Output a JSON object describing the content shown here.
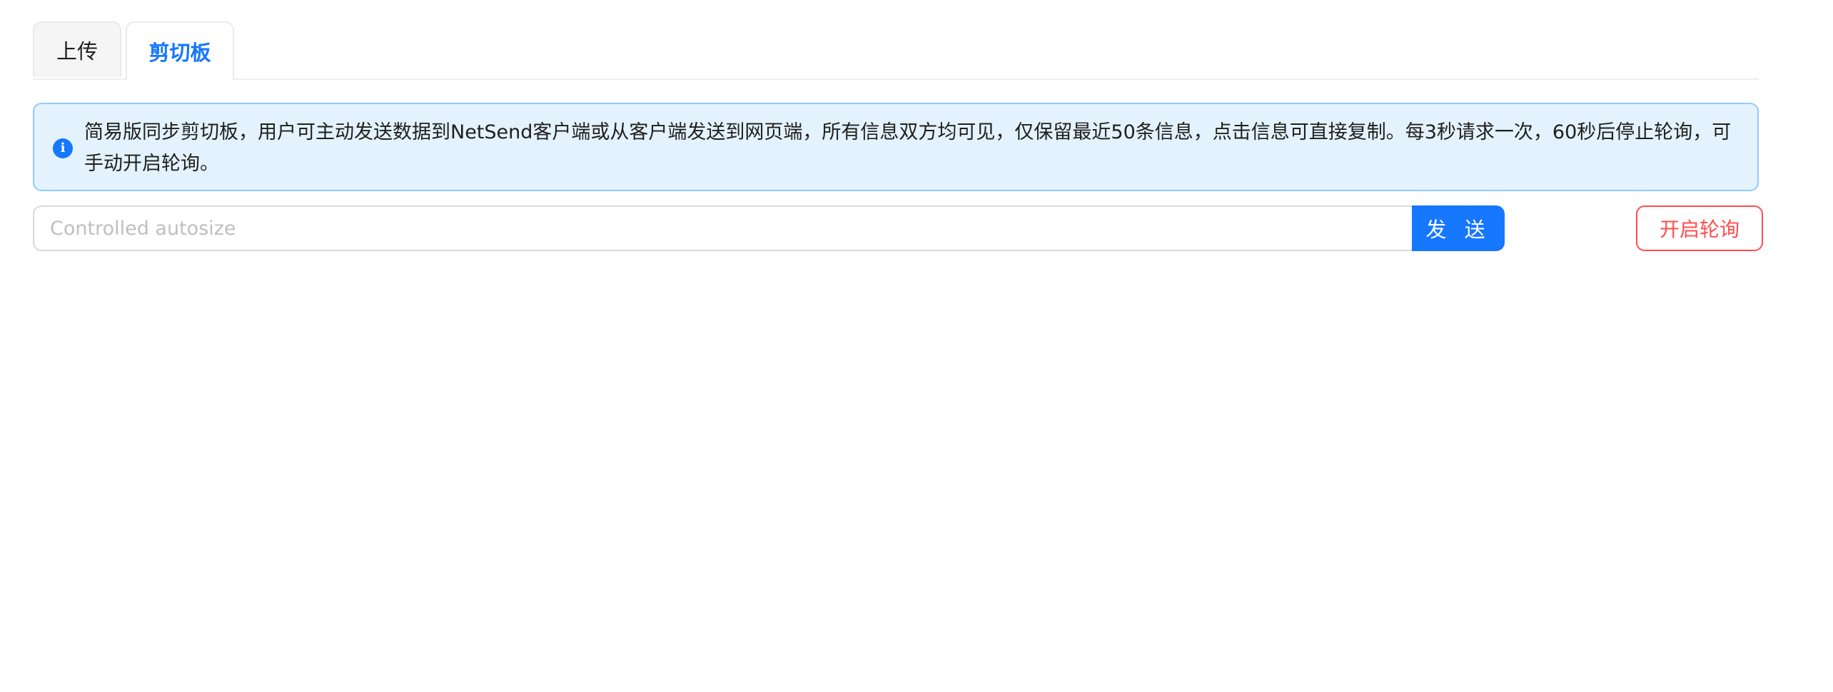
{
  "tabs": {
    "items": [
      {
        "label": "上传",
        "active": false
      },
      {
        "label": "剪切板",
        "active": true
      }
    ]
  },
  "alert": {
    "icon": "info-icon",
    "icon_glyph": "i",
    "text": "简易版同步剪切板，用户可主动发送数据到NetSend客户端或从客户端发送到网页端，所有信息双方均可见，仅保留最近50条信息，点击信息可直接复制。每3秒请求一次，60秒后停止轮询，可手动开启轮询。"
  },
  "composer": {
    "placeholder": "Controlled autosize",
    "value": "",
    "send_label": "发 送"
  },
  "polling": {
    "button_label": "开启轮询"
  },
  "colors": {
    "accent": "#1677ff",
    "danger": "#ff4d4f",
    "alert_bg": "#e3f2fc",
    "alert_border": "#91caff"
  }
}
